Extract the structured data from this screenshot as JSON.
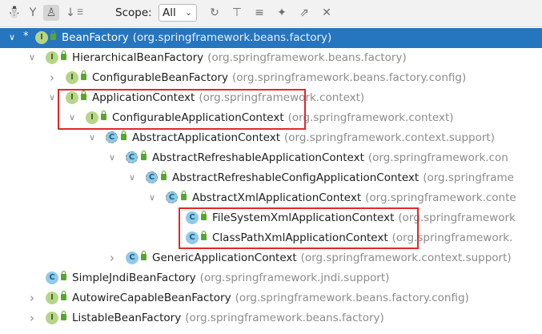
{
  "toolbar": {
    "icons": [
      "person-tree-icon",
      "filter-icon",
      "person-icon",
      "sort-icon",
      "refresh-icon",
      "expand-icon",
      "collapse-icon",
      "pin-icon",
      "export-icon",
      "close-icon"
    ],
    "scope_label": "Scope:",
    "scope_value": "All"
  },
  "tree": [
    {
      "name": "BeanFactory",
      "pkg": "(org.springframework.beans.factory)",
      "kind": "I"
    },
    {
      "name": "HierarchicalBeanFactory",
      "pkg": "(org.springframework.beans.factory)",
      "kind": "I"
    },
    {
      "name": "ConfigurableBeanFactory",
      "pkg": "(org.springframework.beans.factory.config)",
      "kind": "I"
    },
    {
      "name": "ApplicationContext",
      "pkg": "(org.springframework.context)",
      "kind": "I"
    },
    {
      "name": "ConfigurableApplicationContext",
      "pkg": "(org.springframework.context)",
      "kind": "I"
    },
    {
      "name": "AbstractApplicationContext",
      "pkg": "(org.springframework.context.support)",
      "kind": "C"
    },
    {
      "name": "AbstractRefreshableApplicationContext",
      "pkg": "(org.springframework.con",
      "kind": "C"
    },
    {
      "name": "AbstractRefreshableConfigApplicationContext",
      "pkg": "(org.springframe",
      "kind": "C"
    },
    {
      "name": "AbstractXmlApplicationContext",
      "pkg": "(org.springframework.conte",
      "kind": "C"
    },
    {
      "name": "FileSystemXmlApplicationContext",
      "pkg": "(org.springframework",
      "kind": "C"
    },
    {
      "name": "ClassPathXmlApplicationContext",
      "pkg": "(org.springframework.",
      "kind": "C"
    },
    {
      "name": "GenericApplicationContext",
      "pkg": "(org.springframework.context.support)",
      "kind": "C"
    },
    {
      "name": "SimpleJndiBeanFactory",
      "pkg": "(org.springframework.jndi.support)",
      "kind": "C"
    },
    {
      "name": "AutowireCapableBeanFactory",
      "pkg": "(org.springframework.beans.factory.config)",
      "kind": "I"
    },
    {
      "name": "ListableBeanFactory",
      "pkg": "(org.springframework.beans.factory)",
      "kind": "I"
    }
  ]
}
